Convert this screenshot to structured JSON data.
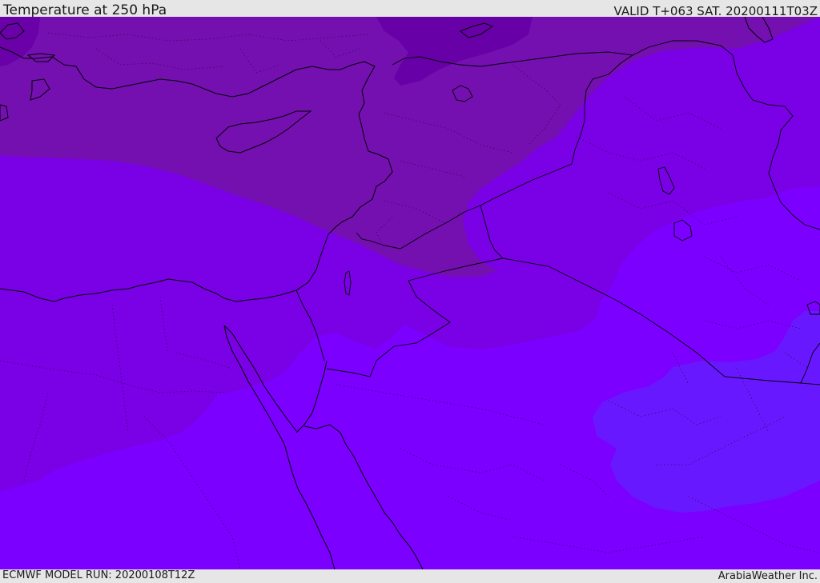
{
  "header": {
    "title": "Temperature at 250 hPa",
    "valid_time": "VALID T+063 SAT. 20200111T03Z"
  },
  "footer": {
    "model_run": "ECMWF MODEL RUN: 20200108T12Z",
    "credit": "ArabiaWeather Inc."
  },
  "colors": {
    "band_coldest": "#6700a6",
    "band_cold": "#7410b0",
    "band_mid_cold": "#7700c4",
    "band_mid": "#7a00e6",
    "band_warm": "#7c00ff",
    "band_warmest": "#6818ff",
    "boundary_line": "#000000"
  }
}
